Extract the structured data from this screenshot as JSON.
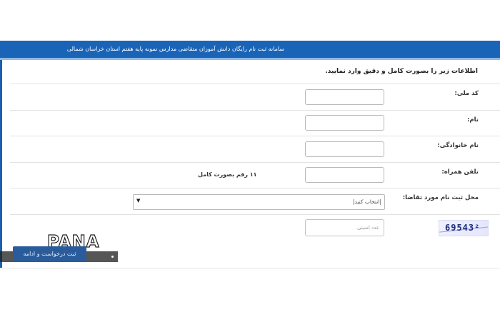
{
  "header": {
    "title": "سامانه ثبت نام رایگان دانش آموزان متقاضی مدارس نمونه پایه هفتم استان خراسان شمالی",
    "color": "#1a64b8"
  },
  "instruction": "اطلاعات زیر را بصورت کامل و دقیق وارد نمایید.",
  "form": {
    "national_code_label": "کد ملی:",
    "first_name_label": "نام:",
    "last_name_label": "نام خانوادگی:",
    "mobile_label": "تلفن همراه:",
    "mobile_hint": "۱۱ رقم بصورت کامل",
    "region_label": "محل ثبت نام مورد تقاضا:",
    "region_selected": "|انتخاب کنید|",
    "captcha_placeholder": "عدد امنیتی",
    "captcha_text": "69543²",
    "submit_label": "ثبت درخواست و ادامه"
  },
  "watermark": {
    "text": "PANA"
  }
}
